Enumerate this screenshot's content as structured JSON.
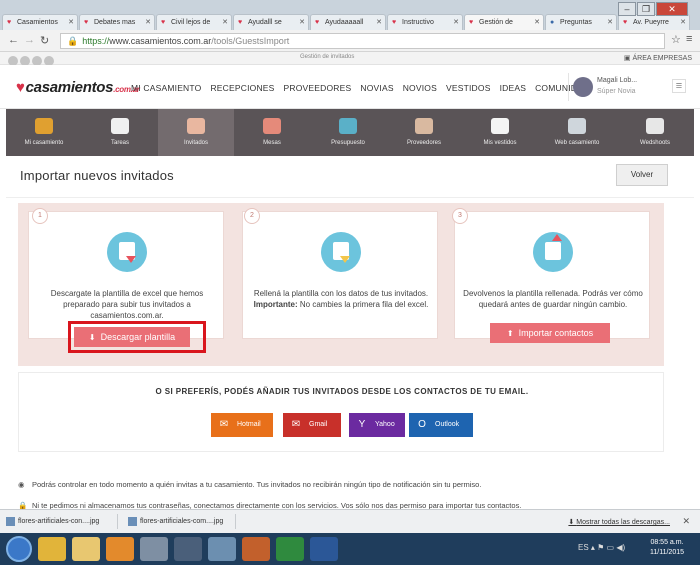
{
  "browser": {
    "tabs": [
      {
        "label": "Casamientos"
      },
      {
        "label": "Debates mas"
      },
      {
        "label": "Civil lejos de"
      },
      {
        "label": "Ayudalll se"
      },
      {
        "label": "Ayudaaaaall"
      },
      {
        "label": "Instructivo"
      },
      {
        "label": "Gestión de"
      },
      {
        "label": "Preguntas"
      },
      {
        "label": "Av. Pueyrre"
      }
    ],
    "url_secure": "https://",
    "url_host": "www.casamientos.com.ar",
    "url_path": "/tools/GuestsImport"
  },
  "strip": {
    "title": "Gestión de invitados",
    "right": "ÁREA EMPRESAS"
  },
  "header": {
    "logo": "casamientos",
    "logo_tld": ".com.ar",
    "nav": [
      "MI CASAMIENTO",
      "RECEPCIONES",
      "PROVEEDORES",
      "NOVIAS",
      "NOVIOS",
      "VESTIDOS",
      "IDEAS",
      "COMUNIDAD"
    ],
    "user_name": "Magali Lob...",
    "user_role": "Súper Novia"
  },
  "tools": [
    {
      "label": "Mi casamiento",
      "color": "#e0a030"
    },
    {
      "label": "Tareas",
      "color": "#f0f0f0"
    },
    {
      "label": "Invitados",
      "color": "#e9b7a0"
    },
    {
      "label": "Mesas",
      "color": "#e58a7a"
    },
    {
      "label": "Presupuesto",
      "color": "#5ab0c8"
    },
    {
      "label": "Proveedores",
      "color": "#d9b9a0"
    },
    {
      "label": "Mis vestidos",
      "color": "#f4f4f4"
    },
    {
      "label": "Web casamiento",
      "color": "#cfd6dc"
    },
    {
      "label": "Wedshoots",
      "color": "#e7e7e7"
    }
  ],
  "page": {
    "title": "Importar nuevos invitados",
    "back_label": "Volver"
  },
  "steps": [
    {
      "num": "1",
      "text": "Descargate la plantilla de excel que hemos preparado para subir tus invitados a casamientos.com.ar.",
      "button": "Descargar plantilla"
    },
    {
      "num": "2",
      "text_pre": "Rellená la plantilla con los datos de tus invitados. ",
      "text_bold": "Importante:",
      "text_post": " No cambies la primera fila del excel."
    },
    {
      "num": "3",
      "text": "Devolvenos la plantilla rellenada. Podrás ver cómo quedará antes de guardar ningún cambio.",
      "button": "Importar contactos"
    }
  ],
  "email": {
    "heading": "O SI PREFERÍS, PODÉS AÑADIR TUS INVITADOS DESDE LOS CONTACTOS DE TU EMAIL.",
    "providers": [
      {
        "label": "Hotmail",
        "color": "#e8701a"
      },
      {
        "label": "Gmail",
        "color": "#c8302a"
      },
      {
        "label": "Yahoo",
        "color": "#6b2aa0"
      },
      {
        "label": "Outlook",
        "color": "#1e64b0"
      }
    ]
  },
  "info": [
    "Podrás controlar en todo momento a quién invitas a tu casamiento. Tus invitados no recibirán ningún tipo de notificación sin tu permiso.",
    "Ni te pedimos ni almacenamos tus contraseñas, conectamos directamente con los servicios. Vos sólo nos das permiso para importar tus contactos."
  ],
  "downloads": {
    "items": [
      "flores-artificiales-con....jpg",
      "flores-artificiales-com....jpg"
    ],
    "show_all": "Mostrar todas las descargas..."
  },
  "taskbar": {
    "lang": "ES",
    "time": "08:55 a.m.",
    "date": "11/11/2015"
  }
}
